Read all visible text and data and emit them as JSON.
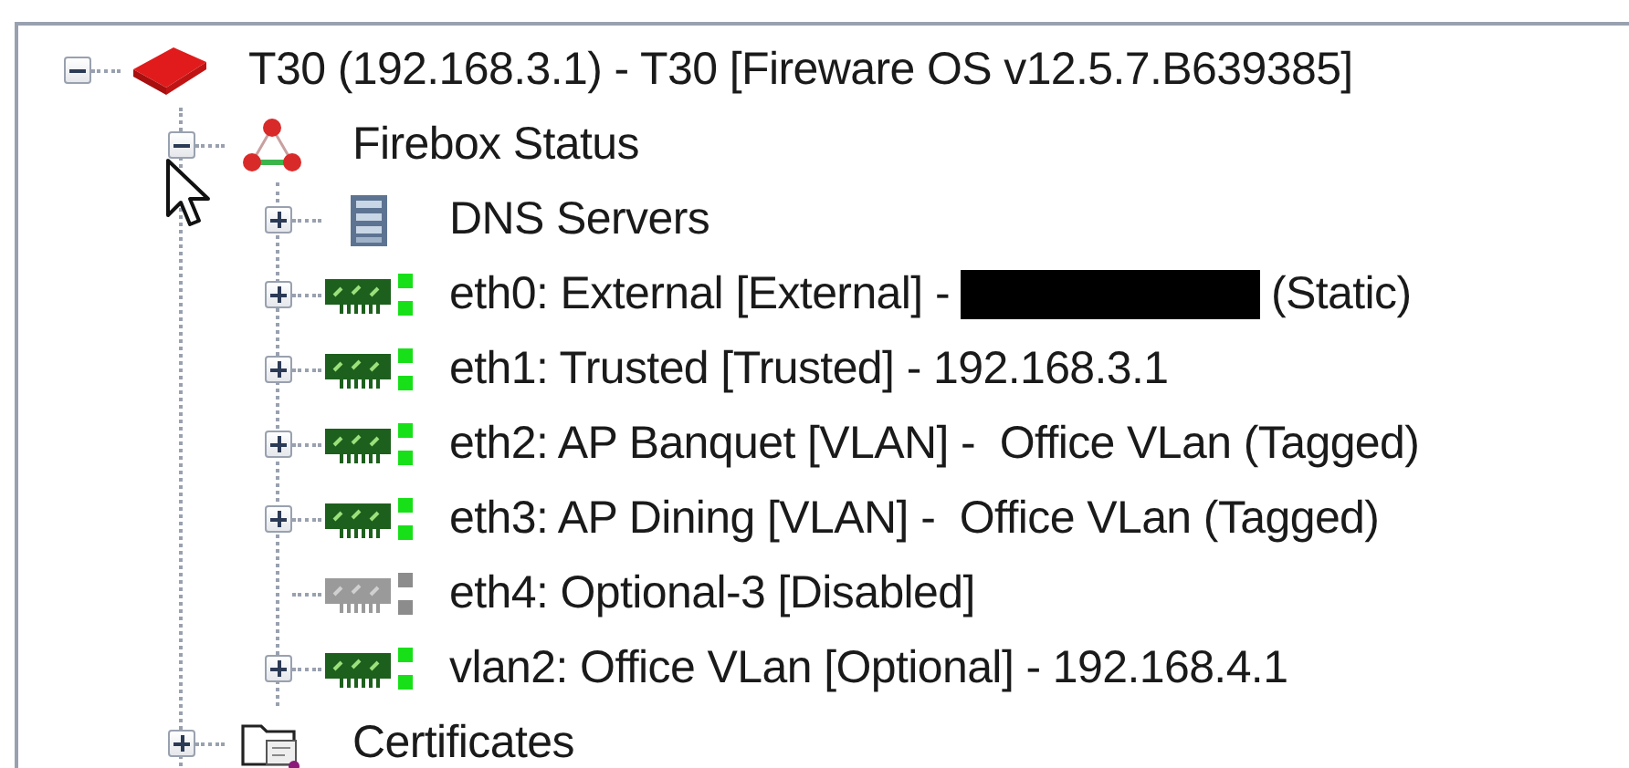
{
  "tree": {
    "label": "T30 (192.168.3.1) - T30 [Fireware OS v12.5.7.B639385]",
    "kind": "device",
    "expandable": true,
    "expanded": true,
    "children": [
      {
        "label": "Firebox Status",
        "kind": "status",
        "expandable": true,
        "expanded": true,
        "children": [
          {
            "label": "DNS Servers",
            "kind": "server",
            "expandable": true,
            "expanded": false
          },
          {
            "label": "eth0: External [External] -",
            "redacted": true,
            "suffix": "(Static)",
            "kind": "interface",
            "enabled": true,
            "expandable": true,
            "expanded": false
          },
          {
            "label": "eth1: Trusted [Trusted] - 192.168.3.1",
            "kind": "interface",
            "enabled": true,
            "expandable": true,
            "expanded": false
          },
          {
            "label": "eth2: AP Banquet [VLAN] -  Office VLan (Tagged)",
            "kind": "interface",
            "enabled": true,
            "expandable": true,
            "expanded": false
          },
          {
            "label": "eth3: AP Dining [VLAN] -  Office VLan (Tagged)",
            "kind": "interface",
            "enabled": true,
            "expandable": true,
            "expanded": false
          },
          {
            "label": "eth4: Optional-3 [Disabled]",
            "kind": "interface",
            "enabled": false,
            "expandable": false
          },
          {
            "label": "vlan2: Office VLan [Optional] - 192.168.4.1",
            "kind": "interface",
            "enabled": true,
            "expandable": true,
            "expanded": false
          }
        ]
      },
      {
        "label": "Certificates",
        "kind": "folder",
        "expandable": true,
        "expanded": false
      }
    ]
  }
}
